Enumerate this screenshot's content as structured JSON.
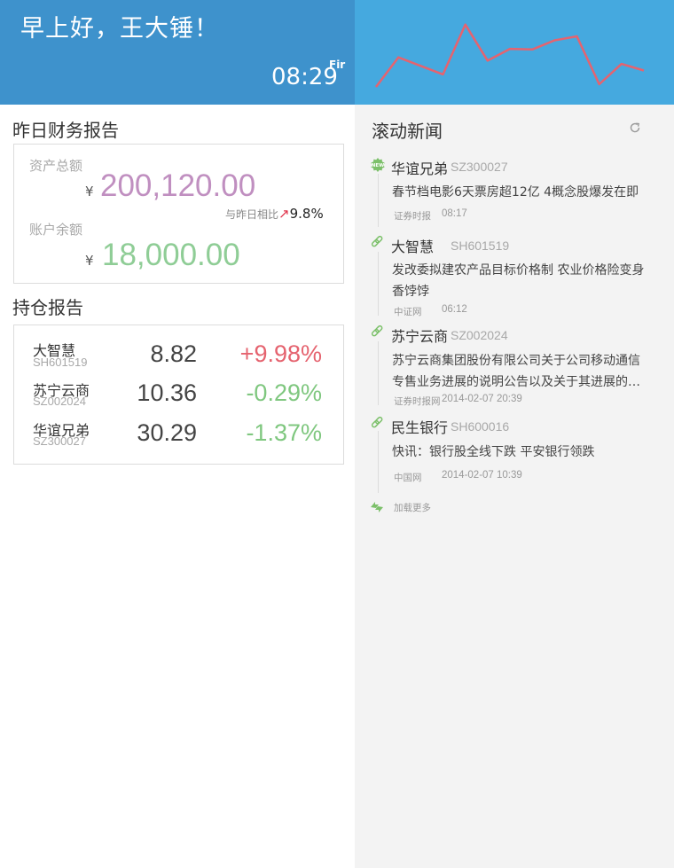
{
  "header": {
    "greeting": "早上好，王大锤！",
    "time": "08:29",
    "weekday": "Fir",
    "sparkline": [
      0.0,
      0.45,
      0.32,
      0.19,
      0.95,
      0.4,
      0.58,
      0.57,
      0.71,
      0.77,
      0.04,
      0.35,
      0.25
    ]
  },
  "finance": {
    "title": "昨日财务报告",
    "assets_label": "资产总额",
    "currency": "¥",
    "assets_value": "200,120.00",
    "compare_label": "与昨日相比",
    "compare_value": "9.8%",
    "balance_label": "账户余额",
    "balance_value": "18,000.00"
  },
  "holdings": {
    "title": "持仓报告",
    "rows": [
      {
        "name": "大智慧",
        "code": "SH601519",
        "price": "8.82",
        "change": "+9.98%",
        "dir": "up"
      },
      {
        "name": "苏宁云商",
        "code": "SZ002024",
        "price": "10.36",
        "change": "-0.29%",
        "dir": "down"
      },
      {
        "name": "华谊兄弟",
        "code": "SZ300027",
        "price": "30.29",
        "change": "-1.37%",
        "dir": "down"
      }
    ]
  },
  "news": {
    "title": "滚动新闻",
    "new_badge": "NEW",
    "items": [
      {
        "stock": "华谊兄弟",
        "code": "SZ300027",
        "line1": "春节档电影6天票房超12亿 4概念股爆发在即",
        "line2": "",
        "source": "证券时报",
        "time": "08:17",
        "icon": "new-badge-icon"
      },
      {
        "stock": "大智慧",
        "code": "SH601519",
        "line1": "发改委拟建农产品目标价格制 农业价格险变身",
        "line2": "香饽饽",
        "source": "中证网",
        "time": "06:12",
        "icon": "link-icon"
      },
      {
        "stock": "苏宁云商",
        "code": "SZ002024",
        "line1": "苏宁云商集团股份有限公司关于公司移动通信",
        "line2": "专售业务进展的说明公告以及关于其进展的…",
        "source": "证券时报网",
        "time": "2014-02-07 20:39",
        "icon": "link-icon"
      },
      {
        "stock": "民生银行",
        "code": "SH600016",
        "line1": "快讯：银行股全线下跌 平安银行领跌",
        "line2": "",
        "source": "中国网",
        "time": "2014-02-07 10:39",
        "icon": "link-icon"
      }
    ],
    "load_more": "加载更多"
  },
  "colors": {
    "header_left": "#3e92cc",
    "header_right": "#45a9df",
    "sparkline": "#e5636f",
    "assets": "#c08fc0",
    "balance": "#8fcd96",
    "up": "#e5636f",
    "down": "#7fc77f",
    "news_accent": "#7cc06a"
  }
}
